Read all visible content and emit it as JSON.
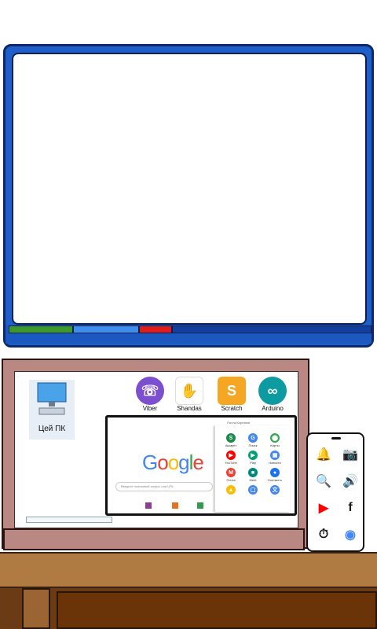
{
  "desktop": {
    "pc_label": "Цей ПК",
    "apps": [
      {
        "label": "Viber",
        "icon": "viber-icon",
        "color": "#7b4fcf"
      },
      {
        "label": "Shandas",
        "icon": "hand-icon",
        "color": "#e54b3c"
      },
      {
        "label": "Scratch",
        "icon": "scratch-icon",
        "color": "#f5a623"
      },
      {
        "label": "Arduino",
        "icon": "arduino-icon",
        "color": "#0d9aa0"
      }
    ]
  },
  "browser": {
    "logo": "Google",
    "top_links": "Почта  Картинки",
    "search_placeholder": "Введите поисковый запрос или URL",
    "apps": [
      {
        "label": "Аккаунт",
        "glyph": "S",
        "color": "#1a8a4a"
      },
      {
        "label": "Поиск",
        "glyph": "G",
        "color": "#4285f4"
      },
      {
        "label": "Карты",
        "glyph": "⬤",
        "color": "#34a853"
      },
      {
        "label": "YouTube",
        "glyph": "▶",
        "color": "#ff0000"
      },
      {
        "label": "Play",
        "glyph": "▶",
        "color": "#00a173"
      },
      {
        "label": "Новости",
        "glyph": "▦",
        "color": "#4285f4"
      },
      {
        "label": "Почта",
        "glyph": "M",
        "color": "#ea4335"
      },
      {
        "label": "Meet",
        "glyph": "■",
        "color": "#00897b"
      },
      {
        "label": "Контакты",
        "glyph": "●",
        "color": "#1a73e8"
      },
      {
        "label": "",
        "glyph": "▲",
        "color": "#fbbc04"
      },
      {
        "label": "",
        "glyph": "▢",
        "color": "#4285f4"
      },
      {
        "label": "",
        "glyph": "文",
        "color": "#4285f4"
      }
    ]
  },
  "phone": {
    "icons": [
      {
        "name": "alarm-icon",
        "glyph": "🔔",
        "color": "#c62828"
      },
      {
        "name": "camera-icon",
        "glyph": "📷",
        "color": "#d32f2f"
      },
      {
        "name": "magnifier-icon",
        "glyph": "🔍",
        "color": "#c62828"
      },
      {
        "name": "speaker-icon",
        "glyph": "🔊",
        "color": "#c62828"
      },
      {
        "name": "youtube-icon",
        "glyph": "▶",
        "color": "#ff0000"
      },
      {
        "name": "facebook-icon",
        "glyph": "f",
        "color": "#1a1a1a"
      },
      {
        "name": "stopwatch-icon",
        "glyph": "⏱",
        "color": "#111111"
      },
      {
        "name": "chrome-icon",
        "glyph": "◉",
        "color": "#4285f4"
      }
    ]
  },
  "colors": {
    "board": "#1f5fc9",
    "monitor": "#b98883",
    "desk": "#b07a43"
  }
}
